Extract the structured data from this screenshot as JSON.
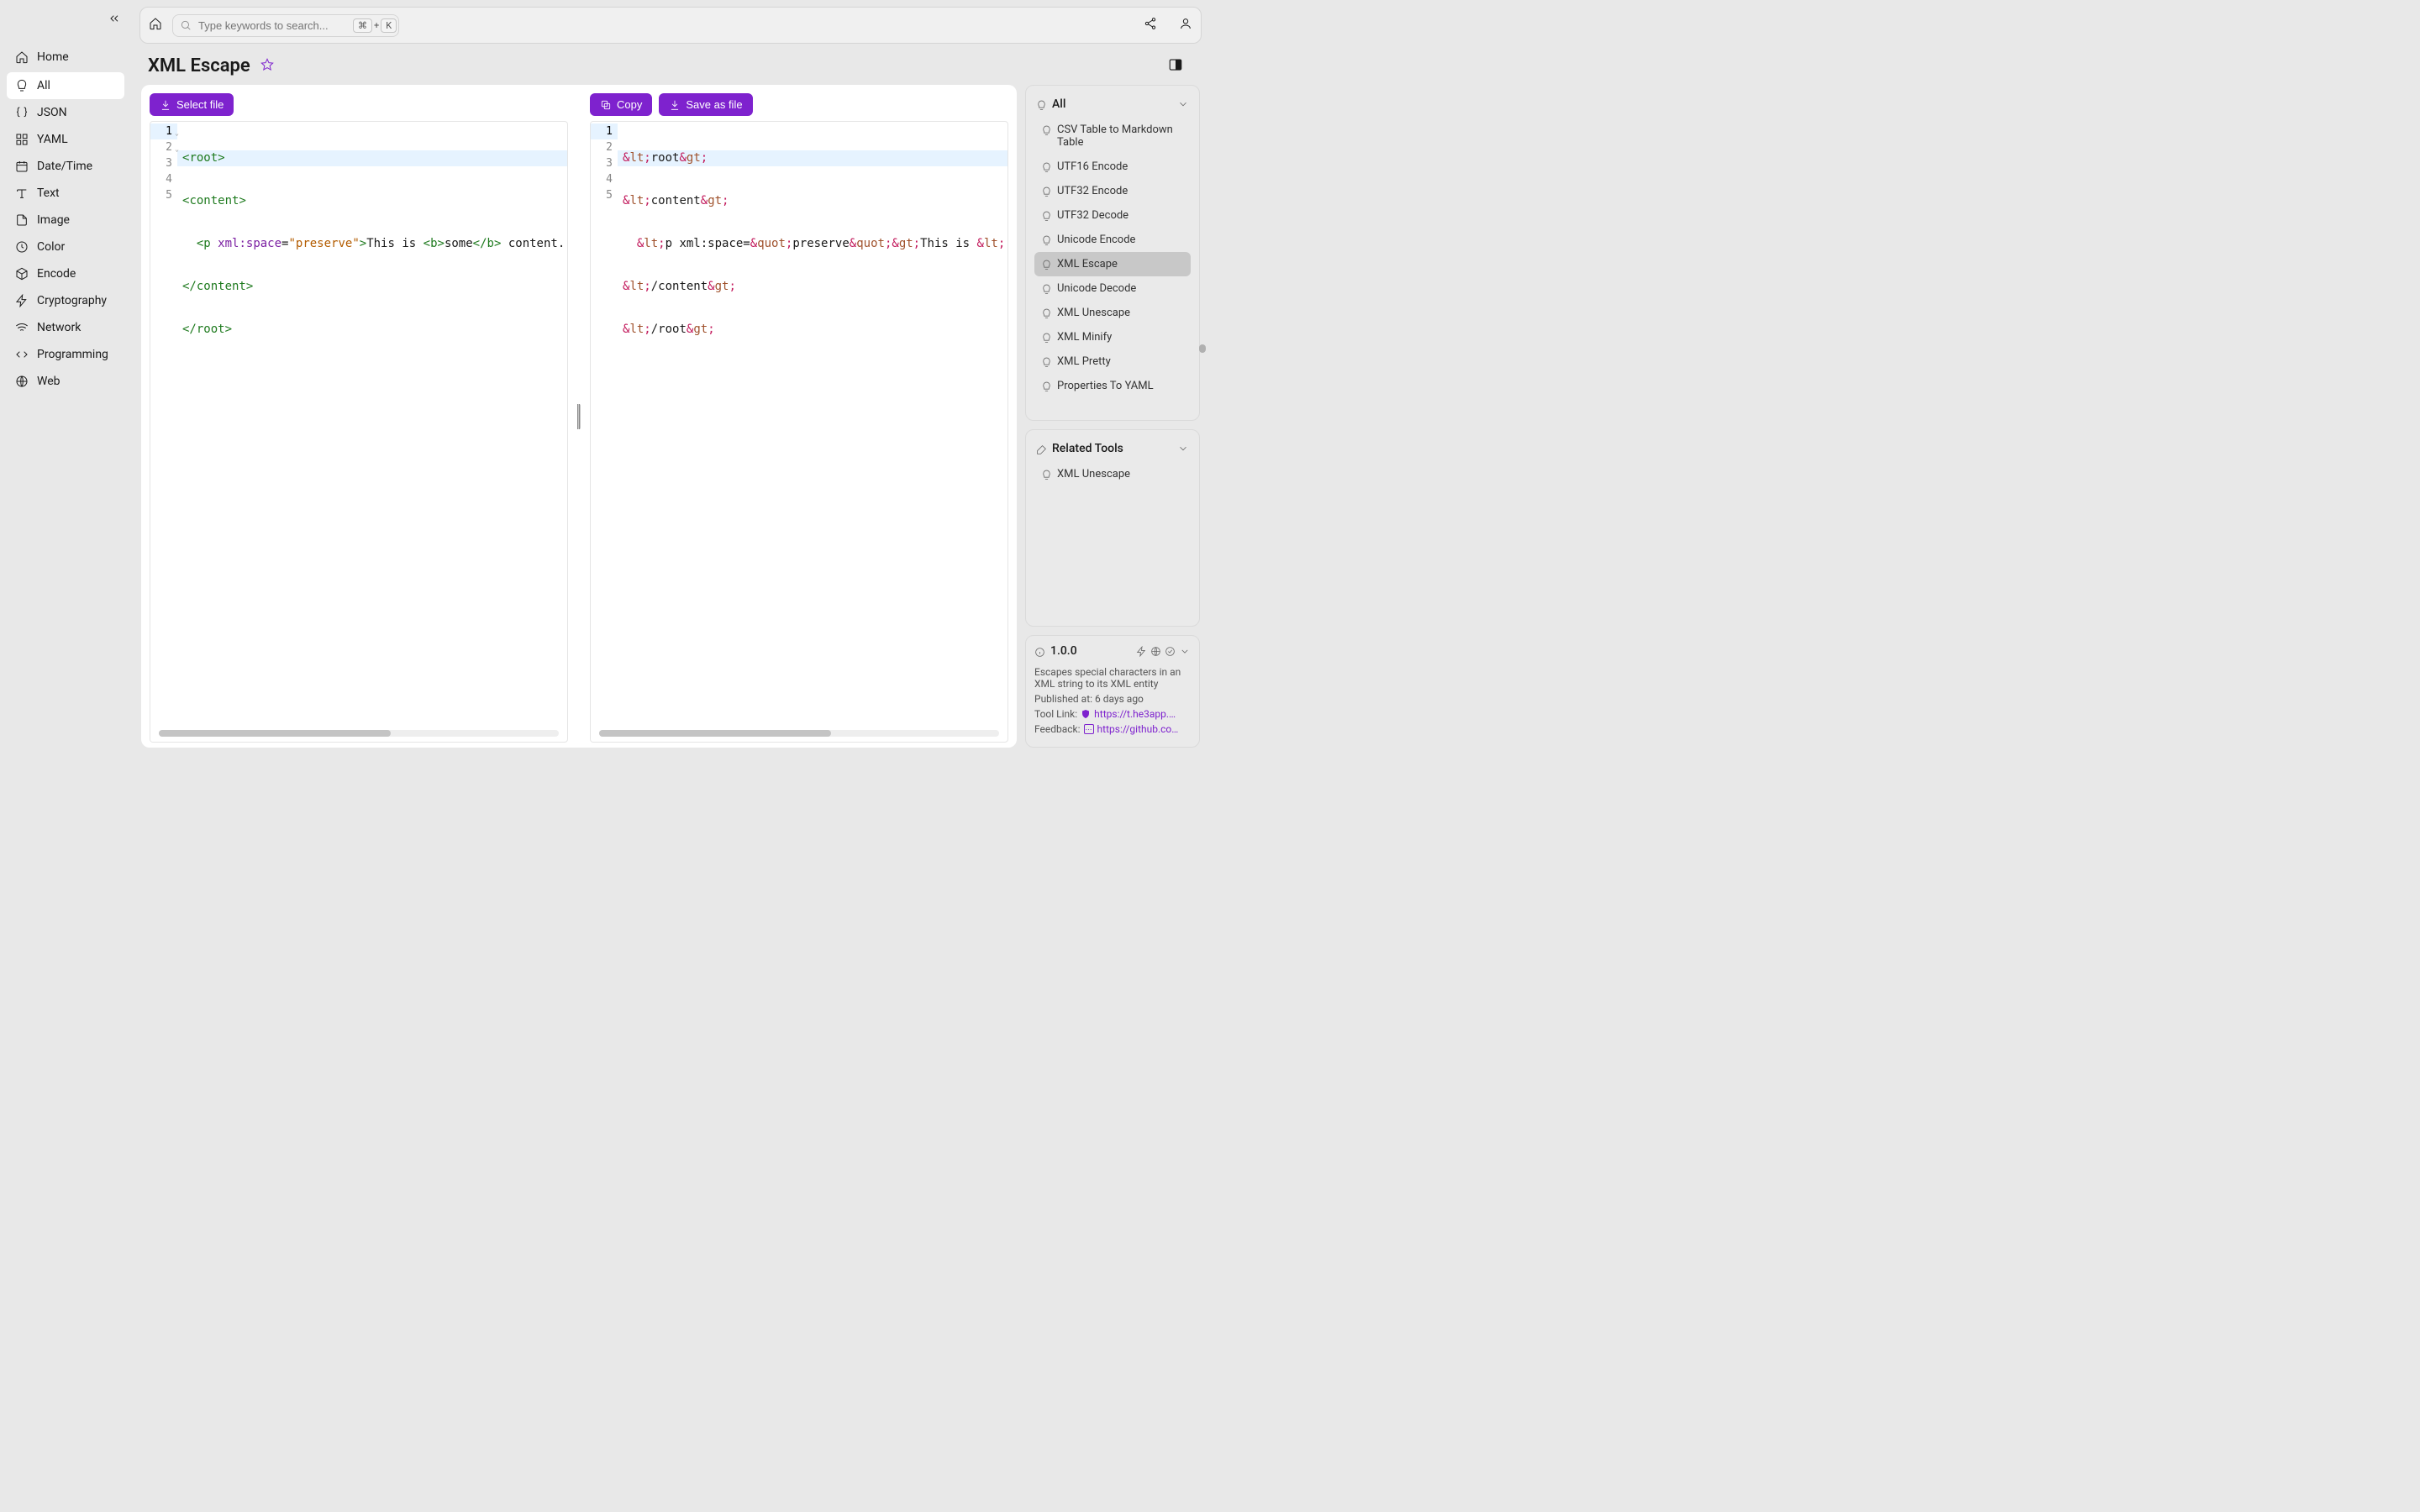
{
  "sidebar": {
    "items": [
      {
        "label": "Home",
        "icon": "home"
      },
      {
        "label": "All",
        "icon": "bell",
        "active": true
      },
      {
        "label": "JSON",
        "icon": "braces"
      },
      {
        "label": "YAML",
        "icon": "grid"
      },
      {
        "label": "Date/Time",
        "icon": "calendar"
      },
      {
        "label": "Text",
        "icon": "text"
      },
      {
        "label": "Image",
        "icon": "file"
      },
      {
        "label": "Color",
        "icon": "clock"
      },
      {
        "label": "Encode",
        "icon": "box"
      },
      {
        "label": "Cryptography",
        "icon": "bolt"
      },
      {
        "label": "Network",
        "icon": "wifi"
      },
      {
        "label": "Programming",
        "icon": "code"
      },
      {
        "label": "Web",
        "icon": "globe"
      }
    ]
  },
  "toolbar": {
    "search_placeholder": "Type keywords to search...",
    "kbd1": "⌘",
    "kbd_plus": "+",
    "kbd2": "K"
  },
  "page": {
    "title": "XML Escape"
  },
  "input_panel": {
    "select_file": "Select file",
    "lines": 5
  },
  "output_panel": {
    "copy": "Copy",
    "save": "Save as file",
    "lines": 5
  },
  "all_box": {
    "title": "All",
    "items": [
      "CSV Table to Markdown Table",
      "UTF16 Encode",
      "UTF32 Encode",
      "UTF32 Decode",
      "Unicode Encode",
      "XML Escape",
      "Unicode Decode",
      "XML Unescape",
      "XML Minify",
      "XML Pretty",
      "Properties To YAML"
    ],
    "active_index": 5
  },
  "related_box": {
    "title": "Related Tools",
    "items": [
      "XML Unescape"
    ]
  },
  "info_box": {
    "version": "1.0.0",
    "description": "Escapes special characters in an XML string to its XML entity",
    "published_label": "Published at: ",
    "published_value": "6 days ago",
    "tool_link_label": "Tool Link: ",
    "tool_link_value": "https://t.he3app.co…",
    "feedback_label": "Feedback: ",
    "feedback_value": "https://github.com/…"
  }
}
